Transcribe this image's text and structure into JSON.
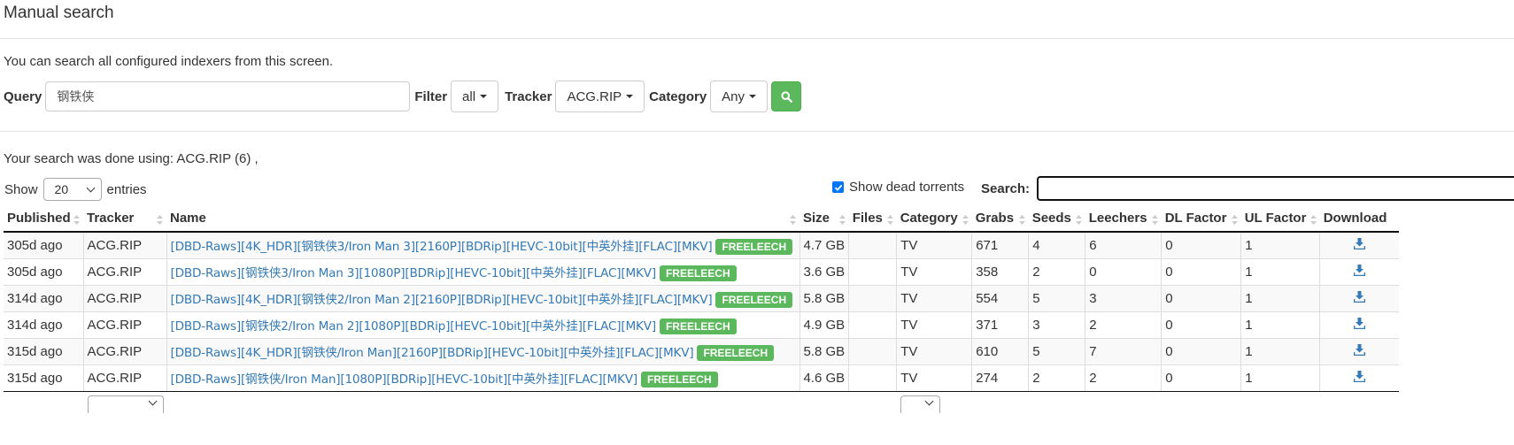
{
  "page": {
    "title": "Manual search",
    "intro": "You can search all configured indexers from this screen.",
    "done_text": "Your search was done using: ACG.RIP (6) ,"
  },
  "search": {
    "query_label": "Query",
    "query_value": "钢铁侠",
    "filter_label": "Filter",
    "filter_value": "all",
    "tracker_label": "Tracker",
    "tracker_value": "ACG.RIP",
    "category_label": "Category",
    "category_value": "Any",
    "go_icon": "search-icon"
  },
  "table_controls": {
    "show_label": "Show",
    "entries_value": "20",
    "entries_label": "entries",
    "show_dead_label": "Show dead torrents",
    "show_dead_checked": true,
    "search_label": "Search:"
  },
  "columns": [
    "Published",
    "Tracker",
    "Name",
    "Size",
    "Files",
    "Category",
    "Grabs",
    "Seeds",
    "Leechers",
    "DL Factor",
    "UL Factor",
    "Download"
  ],
  "rows": [
    {
      "published": "305d ago",
      "tracker": "ACG.RIP",
      "name": "[DBD-Raws][4K_HDR][钢铁侠3/Iron Man 3][2160P][BDRip][HEVC-10bit][中英外挂][FLAC][MKV]",
      "badge": "FREELEECH",
      "size": "4.7 GB",
      "files": "",
      "category": "TV",
      "grabs": "671",
      "seeds": "4",
      "leechers": "6",
      "dl": "0",
      "ul": "1"
    },
    {
      "published": "305d ago",
      "tracker": "ACG.RIP",
      "name": "[DBD-Raws][钢铁侠3/Iron Man 3][1080P][BDRip][HEVC-10bit][中英外挂][FLAC][MKV]",
      "badge": "FREELEECH",
      "size": "3.6 GB",
      "files": "",
      "category": "TV",
      "grabs": "358",
      "seeds": "2",
      "leechers": "0",
      "dl": "0",
      "ul": "1"
    },
    {
      "published": "314d ago",
      "tracker": "ACG.RIP",
      "name": "[DBD-Raws][4K_HDR][钢铁侠2/Iron Man 2][2160P][BDRip][HEVC-10bit][中英外挂][FLAC][MKV]",
      "badge": "FREELEECH",
      "size": "5.8 GB",
      "files": "",
      "category": "TV",
      "grabs": "554",
      "seeds": "5",
      "leechers": "3",
      "dl": "0",
      "ul": "1"
    },
    {
      "published": "314d ago",
      "tracker": "ACG.RIP",
      "name": "[DBD-Raws][钢铁侠2/Iron Man 2][1080P][BDRip][HEVC-10bit][中英外挂][FLAC][MKV]",
      "badge": "FREELEECH",
      "size": "4.9 GB",
      "files": "",
      "category": "TV",
      "grabs": "371",
      "seeds": "3",
      "leechers": "2",
      "dl": "0",
      "ul": "1"
    },
    {
      "published": "315d ago",
      "tracker": "ACG.RIP",
      "name": "[DBD-Raws][4K_HDR][钢铁侠/Iron Man][2160P][BDRip][HEVC-10bit][中英外挂][FLAC][MKV]",
      "badge": "FREELEECH",
      "size": "5.8 GB",
      "files": "",
      "category": "TV",
      "grabs": "610",
      "seeds": "5",
      "leechers": "7",
      "dl": "0",
      "ul": "1"
    },
    {
      "published": "315d ago",
      "tracker": "ACG.RIP",
      "name": "[DBD-Raws][钢铁侠/Iron Man][1080P][BDRip][HEVC-10bit][中英外挂][FLAC][MKV]",
      "badge": "FREELEECH",
      "size": "4.6 GB",
      "files": "",
      "category": "TV",
      "grabs": "274",
      "seeds": "2",
      "leechers": "2",
      "dl": "0",
      "ul": "1"
    }
  ],
  "colors": {
    "accent_green": "#5cb85c",
    "link_blue": "#337ab7",
    "download_icon": "#337ab7"
  }
}
